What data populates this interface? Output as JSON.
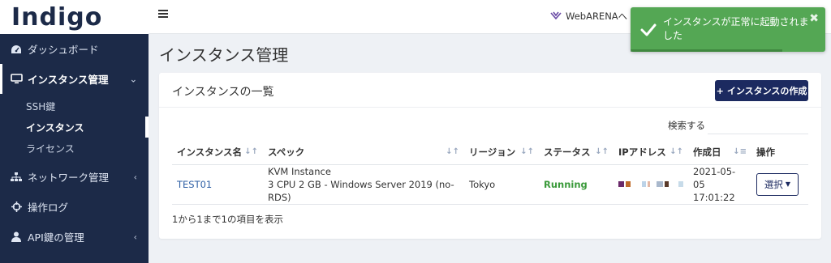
{
  "app": {
    "logo": "Indigo"
  },
  "sidebar": {
    "items": [
      {
        "label": "ダッシュボード",
        "icon": "dashboard-icon"
      },
      {
        "label": "インスタンス管理",
        "icon": "monitor-icon",
        "active": true,
        "children": [
          {
            "label": "SSH鍵"
          },
          {
            "label": "インスタンス",
            "current": true
          },
          {
            "label": "ライセンス"
          }
        ]
      },
      {
        "label": "ネットワーク管理",
        "icon": "network-icon"
      },
      {
        "label": "操作ログ",
        "icon": "crosshair-icon"
      },
      {
        "label": "API鍵の管理",
        "icon": "user-icon"
      }
    ]
  },
  "topbar": {
    "webarena_label": "WebARENAへ"
  },
  "toast": {
    "message": "インスタンスが正常に起動されました",
    "close": "✖",
    "color": "#54a754"
  },
  "page": {
    "title": "インスタンス管理"
  },
  "card": {
    "title": "インスタンスの一覧",
    "create_button": "インスタンスの作成",
    "search_label": "検索する",
    "search_value": "",
    "footer": "1から1まで1の項目を表示"
  },
  "table": {
    "columns": [
      "インスタンス名",
      "スペック",
      "リージョン",
      "ステータス",
      "IPアドレス",
      "作成日",
      "操作"
    ],
    "rows": [
      {
        "name": "TEST01",
        "spec_line1": "KVM Instance",
        "spec_line2": "3 CPU 2 GB - Windows Server 2019 (no-RDS)",
        "region": "Tokyo",
        "status": "Running",
        "created_date": "2021-05-05",
        "created_time": "17:01:22",
        "action": "選択"
      }
    ]
  },
  "colors": {
    "sidebar": "#1c2a48",
    "accent": "#1c2a60",
    "status_running": "#3a9a3a",
    "link": "#2e5fa5"
  }
}
